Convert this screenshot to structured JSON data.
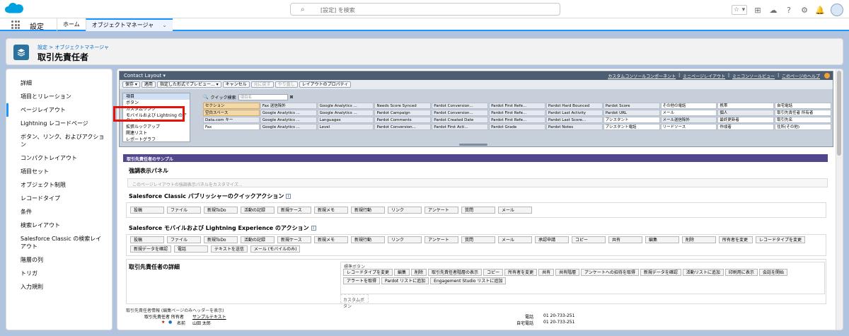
{
  "header": {
    "search_placeholder": "[設定] を検索",
    "icons": [
      "star-icon",
      "chevron-down-icon",
      "add-icon",
      "trailhead-icon",
      "help-icon",
      "gear-icon",
      "bell-icon",
      "avatar"
    ]
  },
  "nav": {
    "app_name": "設定",
    "tabs": [
      {
        "label": "ホーム"
      },
      {
        "label": "オブジェクトマネージャ",
        "chevron": "⌄"
      }
    ]
  },
  "page": {
    "breadcrumb": "設定 > オブジェクトマネージャ",
    "title": "取引先責任者"
  },
  "sidebar": {
    "items": [
      {
        "label": "詳細"
      },
      {
        "label": "項目とリレーション"
      },
      {
        "label": "ページレイアウト",
        "active": true
      },
      {
        "label": "Lightning レコードページ"
      },
      {
        "label": "ボタン、リンク、およびアクション"
      },
      {
        "label": "コンパクトレイアウト"
      },
      {
        "label": "項目セット"
      },
      {
        "label": "オブジェクト制限"
      },
      {
        "label": "レコードタイプ"
      },
      {
        "label": "条件"
      },
      {
        "label": "検索レイアウト"
      },
      {
        "label": "Salesforce Classic の検索レイアウト"
      },
      {
        "label": "階層の列"
      },
      {
        "label": "トリガ"
      },
      {
        "label": "入力規則"
      }
    ]
  },
  "palette": {
    "title": "Contact Layout ▾",
    "links": [
      "カスタムコンソールコンポーネント",
      "ミニページレイアウト",
      "ミニコンソールビュー",
      "このページのヘルプ"
    ],
    "toolbar": [
      {
        "label": "保存 ▾"
      },
      {
        "label": "適用"
      },
      {
        "label": "指定した形式でプレビュー... ▾"
      },
      {
        "label": "キャンセル"
      },
      {
        "label": "元に戻す",
        "disabled": true
      },
      {
        "label": "やり直し",
        "disabled": true
      },
      {
        "label": "レイアウトのプロパティ"
      }
    ],
    "categories": [
      {
        "label": "項目",
        "selected": true
      },
      {
        "label": "ボタン"
      },
      {
        "label": "カスタムリンク"
      },
      {
        "label": "モバイルおよび Lightning のアクション"
      },
      {
        "label": "拡張ルックアップ"
      },
      {
        "label": "関連リスト"
      },
      {
        "label": "レポートグラフ"
      }
    ],
    "quick_find_label": "クイック検索",
    "quick_find_placeholder": "項目名",
    "fields": [
      {
        "label": "セクション",
        "style": "gold"
      },
      {
        "label": "Fax 送信除外"
      },
      {
        "label": "Google Analytics ..."
      },
      {
        "label": "Needs Score Synced"
      },
      {
        "label": "Pardot Conversion..."
      },
      {
        "label": "Pardot First Refe..."
      },
      {
        "label": "Pardot Hard Bounced"
      },
      {
        "label": "Pardot Score"
      },
      {
        "label": "その他の電話",
        "style": "plain"
      },
      {
        "label": "携帯",
        "style": "plain"
      },
      {
        "label": "自宅電話",
        "style": "plain"
      },
      {
        "label": "空白スペース",
        "style": "gold"
      },
      {
        "label": "Google Analytics ..."
      },
      {
        "label": "Google Analytics ..."
      },
      {
        "label": "Pardot Campaign"
      },
      {
        "label": "Pardot Conversion..."
      },
      {
        "label": "Pardot First Refe..."
      },
      {
        "label": "Pardot Last Activity"
      },
      {
        "label": "Pardot URL"
      },
      {
        "label": "メール",
        "style": "plain"
      },
      {
        "label": "個人"
      },
      {
        "label": "取引先責任者 所有者",
        "style": "plain"
      },
      {
        "label": "Data.com キー"
      },
      {
        "label": "Google Analytics ..."
      },
      {
        "label": "Languages"
      },
      {
        "label": "Pardot Comments"
      },
      {
        "label": "Pardot Created Date"
      },
      {
        "label": "Pardot First Refe..."
      },
      {
        "label": "Pardot Last Score..."
      },
      {
        "label": "アシスタント",
        "style": "plain"
      },
      {
        "label": "メール送信除外"
      },
      {
        "label": "最終更新者",
        "style": "plain"
      },
      {
        "label": "取引先名",
        "style": "plain"
      },
      {
        "label": "Fax",
        "style": "plain"
      },
      {
        "label": "Google Analytics ..."
      },
      {
        "label": "Level"
      },
      {
        "label": "Pardot Conversion..."
      },
      {
        "label": "Pardot First Acti..."
      },
      {
        "label": "Pardot Grade"
      },
      {
        "label": "Pardot Notes"
      },
      {
        "label": "アシスタント電話",
        "style": "plain"
      },
      {
        "label": "リードソース",
        "style": "plain"
      },
      {
        "label": "作成者",
        "style": "plain"
      },
      {
        "label": "住所(その他)",
        "style": "plain"
      }
    ]
  },
  "layout": {
    "sample_bar": "取引先責任者のサンプル",
    "highlights_title": "強調表示パネル",
    "highlights_placeholder": "このページレイアウトの強調表示パネルをカスタマイズ...",
    "classic_title": "Salesforce Classic パブリッシャーのクイックアクション",
    "classic_actions": [
      "投稿",
      "ファイル",
      "新規ToDo",
      "活動の記録",
      "新規ケース",
      "新規メモ",
      "新規行動",
      "リンク",
      "アンケート",
      "質問",
      "メール"
    ],
    "mobile_title": "Salesforce モバイルおよび Lightning Experience のアクション",
    "mobile_actions": [
      "投稿",
      "ファイル",
      "新規ToDo",
      "活動の記録",
      "新規ケース",
      "新規メモ",
      "新規行動",
      "リンク",
      "アンケート",
      "質問",
      "メール",
      "承認申請",
      "コピー",
      "共有",
      "編集",
      "削除",
      "所有者を変更",
      "レコードタイプを変更",
      "新規データを確認",
      "電話",
      "テキストを送信",
      "メール (モバイルのみ)"
    ],
    "detail_title": "取引先責任者の詳細",
    "standard_buttons_label": "標準ボタン",
    "standard_buttons": [
      "レコードタイプを変更",
      "編集",
      "削除",
      "取引先責任者階層の表示",
      "コピー",
      "所有者を変更",
      "共有",
      "共有階層",
      "アンケートへの招待を取得",
      "新規データを確認",
      "活動リストに追加",
      "印刷用に表示",
      "会話を開始",
      "アラートを取得",
      "Pardot リストに追加",
      "Engagement Studio リストに追加"
    ],
    "custom_buttons_label": "カスタムボタン",
    "info_header": "取引先責任者情報 (編集ページのみヘッダーを表示)",
    "rows": [
      {
        "label": "取引先責任者 所有者",
        "value": "サンプルテキスト",
        "right_label": "電話",
        "right_value": "01 20-733-251"
      },
      {
        "label": "名前",
        "value": "山田 太郎",
        "right_label": "自宅電話",
        "right_value": "01 20-733-251"
      }
    ]
  }
}
